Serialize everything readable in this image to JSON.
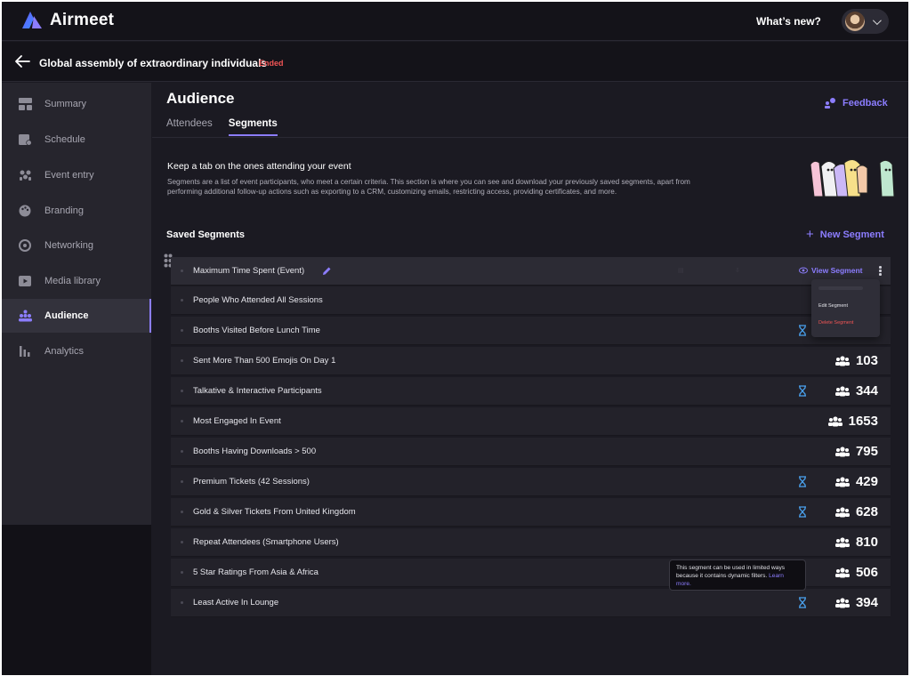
{
  "app": {
    "name": "Airmeet"
  },
  "topbar": {
    "whats_new": "What’s new?"
  },
  "event": {
    "title": "Global assembly of extraordinary individuals",
    "status": "Ended"
  },
  "sidebar": {
    "items": [
      {
        "label": "Summary",
        "icon": "summary-icon"
      },
      {
        "label": "Schedule",
        "icon": "schedule-icon"
      },
      {
        "label": "Event entry",
        "icon": "event-entry-icon"
      },
      {
        "label": "Branding",
        "icon": "branding-icon"
      },
      {
        "label": "Networking",
        "icon": "networking-icon"
      },
      {
        "label": "Media library",
        "icon": "media-library-icon"
      },
      {
        "label": "Audience",
        "icon": "audience-icon",
        "active": true
      },
      {
        "label": "Analytics",
        "icon": "analytics-icon"
      }
    ]
  },
  "main": {
    "title": "Audience",
    "feedback": "Feedback",
    "tabs": [
      {
        "label": "Attendees"
      },
      {
        "label": "Segments",
        "active": true
      }
    ],
    "intro_title": "Keep a tab on the ones attending your event",
    "intro_desc": "Segments are a list of event participants, who meet a certain criteria. This section is where you can see and download your previously saved segments, apart from performing additional follow-up actions such as exporting to a CRM, customizing emails, restricting access, providing certificates, and more.",
    "saved_title": "Saved Segments",
    "new_segment": "New Segment"
  },
  "segments": [
    {
      "name": "Maximum Time Spent (Event)",
      "view_label": "View Segment"
    },
    {
      "name": "People Who Attended All Sessions"
    },
    {
      "name": "Booths Visited Before Lunch Time",
      "dynamic": true
    },
    {
      "name": "Sent More Than 500 Emojis On Day 1",
      "count": "103"
    },
    {
      "name": "Talkative & Interactive Participants",
      "dynamic": true,
      "count": "344"
    },
    {
      "name": "Most Engaged In Event",
      "count": "1653"
    },
    {
      "name": "Booths Having Downloads > 500",
      "count": "795"
    },
    {
      "name": "Premium Tickets (42 Sessions)",
      "dynamic": true,
      "count": "429"
    },
    {
      "name": "Gold & Silver Tickets From United Kingdom",
      "dynamic": true,
      "count": "628"
    },
    {
      "name": "Repeat Attendees (Smartphone Users)",
      "count": "810"
    },
    {
      "name": "5 Star Ratings From Asia & Africa",
      "count": "506"
    },
    {
      "name": "Least Active In Lounge",
      "dynamic": true,
      "count": "394"
    }
  ],
  "menu": {
    "edit": "Edit Segment",
    "delete": "Delete Segment"
  },
  "tooltip": {
    "text": "This segment can be used in limited ways because it contains dynamic filters.",
    "link": "Learn more."
  },
  "colors": {
    "accent": "#8c7dff",
    "danger": "#f25555",
    "dynamic": "#4aa3f0"
  }
}
